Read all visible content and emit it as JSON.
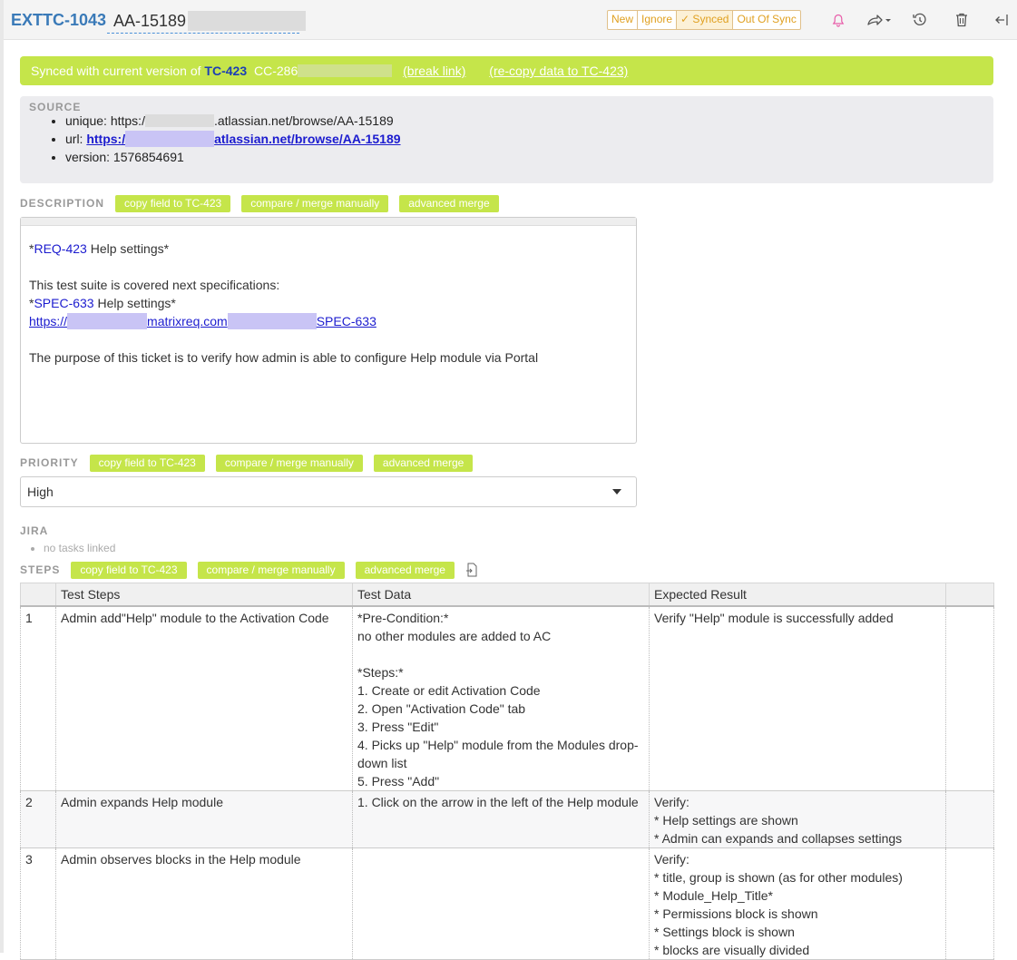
{
  "header": {
    "item_id": "EXTTC-1043",
    "title": "AA-15189",
    "status_buttons": [
      "New",
      "Ignore",
      "✓ Synced",
      "Out Of Sync"
    ]
  },
  "sync": {
    "prefix": "Synced with current version of",
    "target": "TC-423",
    "code": "CC-286",
    "break_link": "(break link)",
    "recopy": "(re-copy data to TC-423)"
  },
  "source": {
    "label": "SOURCE",
    "unique_label": "unique:",
    "unique_pre": "https:/",
    "unique_post": ".atlassian.net/browse/AA-15189",
    "url_label": "url:",
    "url_pre": "https:/",
    "url_post": "atlassian.net/browse/AA-15189",
    "version_label": "version:",
    "version": "1576854691"
  },
  "buttons": {
    "copy": "copy field to TC-423",
    "compare": "compare / merge manually",
    "advanced": "advanced merge"
  },
  "description": {
    "label": "DESCRIPTION",
    "line1_ref": "REQ-423",
    "line1_rest": " Help settings*",
    "line2": "This test suite is covered next specifications:",
    "line3_ref": "SPEC-633",
    "line3_rest": " Help settings*",
    "link_pre": "https://",
    "link_mid": "matrixreq.com",
    "link_post": "SPEC-633",
    "line5": "The purpose of this ticket is to verify how admin is able to configure Help module via Portal"
  },
  "priority": {
    "label": "PRIORITY",
    "value": "High"
  },
  "jira": {
    "label": "JIRA",
    "empty": "no tasks linked"
  },
  "steps": {
    "label": "STEPS",
    "columns": [
      "Test Steps",
      "Test Data",
      "Expected Result"
    ],
    "rows": [
      {
        "num": "1",
        "step": "Admin add\"Help\" module to the Activation Code",
        "data": [
          "*Pre-Condition:*",
          "no other modules are added to AC",
          "",
          "*Steps:*",
          "1. Create or edit Activation Code",
          "2. Open \"Activation Code\" tab",
          "3. Press \"Edit\"",
          "4. Picks up \"Help\" module from the Modules drop-",
          "down list",
          "5. Press \"Add\""
        ],
        "expected": [
          "Verify \"Help\" module is successfully added"
        ]
      },
      {
        "num": "2",
        "step": "Admin expands Help module",
        "data": [
          "1. Click on the arrow in the left of the Help  module"
        ],
        "expected": [
          "Verify:",
          "* Help  settings are shown",
          "* Admin can expands and collapses settings"
        ]
      },
      {
        "num": "3",
        "step": "Admin observes blocks in the  Help module",
        "data": [],
        "expected": [
          "Verify:",
          "* title, group  is shown (as for other modules)",
          "* Module_Help_Title*",
          "* Permissions block is shown",
          "* Settings block is  shown",
          "* blocks are visually divided"
        ]
      }
    ]
  },
  "icons": [
    "bell-icon",
    "share-icon",
    "history-icon",
    "trash-icon",
    "collapse-icon",
    "add-file-icon"
  ],
  "colors": {
    "accent_green": "#c5e54a",
    "id_blue": "#3a7ab8",
    "link_blue": "#1c1ccf",
    "status_orange": "#e0a020"
  }
}
